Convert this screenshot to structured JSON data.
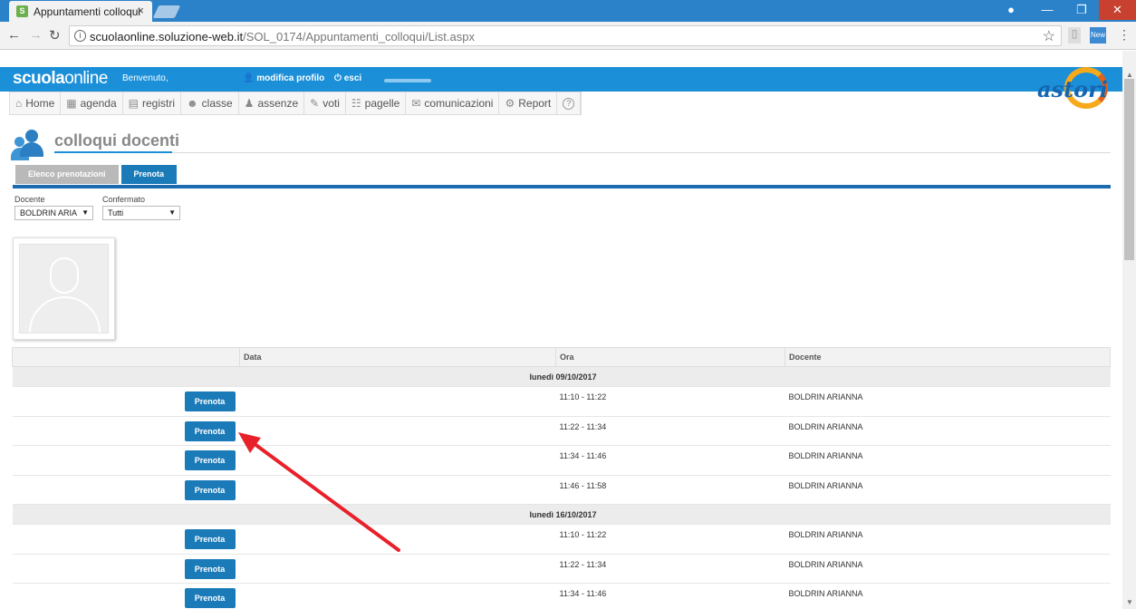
{
  "browser": {
    "tab_title": "Appuntamenti colloqui",
    "tab_close": "×",
    "url_host": "scuolaonline.soluzione-web.it",
    "url_path": "/SOL_0174/Appuntamenti_colloqui/List.aspx",
    "new_ext": "New"
  },
  "header": {
    "logo_bold": "scuola",
    "logo_light": "online",
    "welcome": "Benvenuto,",
    "profile": "modifica profilo",
    "logout": "esci",
    "brand": "astori"
  },
  "menu": {
    "items": [
      {
        "icon": "home-icon",
        "glyph": "⌂",
        "label": "Home"
      },
      {
        "icon": "calendar-icon",
        "glyph": "▦",
        "label": "agenda"
      },
      {
        "icon": "register-icon",
        "glyph": "▤",
        "label": "registri"
      },
      {
        "icon": "class-icon",
        "glyph": "☻",
        "label": "classe"
      },
      {
        "icon": "absence-icon",
        "glyph": "♟",
        "label": "assenze"
      },
      {
        "icon": "edit-icon",
        "glyph": "✎",
        "label": "voti"
      },
      {
        "icon": "report-card-icon",
        "glyph": "☷",
        "label": "pagelle"
      },
      {
        "icon": "mail-icon",
        "glyph": "✉",
        "label": "comunicazioni"
      },
      {
        "icon": "gear-icon",
        "glyph": "⚙",
        "label": "Report"
      },
      {
        "icon": "help-icon",
        "glyph": "?",
        "label": ""
      }
    ]
  },
  "page": {
    "title": "colloqui docenti",
    "tabs": [
      {
        "label": "Elenco prenotazioni",
        "active": false
      },
      {
        "label": "Prenota",
        "active": true
      }
    ],
    "filters": {
      "docente_label": "Docente",
      "docente_value": "BOLDRIN ARIA",
      "confermato_label": "Confermato",
      "confermato_value": "Tutti"
    }
  },
  "table": {
    "headers": [
      "",
      "Data",
      "Ora",
      "Docente"
    ],
    "groups": [
      {
        "date": "lunedì 09/10/2017",
        "rows": [
          {
            "button": "Prenota",
            "ora": "11:10 - 11:22",
            "docente": "BOLDRIN ARIANNA"
          },
          {
            "button": "Prenota",
            "ora": "11:22 - 11:34",
            "docente": "BOLDRIN ARIANNA"
          },
          {
            "button": "Prenota",
            "ora": "11:34 - 11:46",
            "docente": "BOLDRIN ARIANNA"
          },
          {
            "button": "Prenota",
            "ora": "11:46 - 11:58",
            "docente": "BOLDRIN ARIANNA"
          }
        ]
      },
      {
        "date": "lunedì 16/10/2017",
        "rows": [
          {
            "button": "Prenota",
            "ora": "11:10 - 11:22",
            "docente": "BOLDRIN ARIANNA"
          },
          {
            "button": "Prenota",
            "ora": "11:22 - 11:34",
            "docente": "BOLDRIN ARIANNA"
          },
          {
            "button": "Prenota",
            "ora": "11:34 - 11:46",
            "docente": "BOLDRIN ARIANNA"
          }
        ]
      }
    ]
  },
  "colors": {
    "accent": "#1b8fd8",
    "button": "#1b7ab8",
    "annotation_arrow": "#e8202a"
  }
}
